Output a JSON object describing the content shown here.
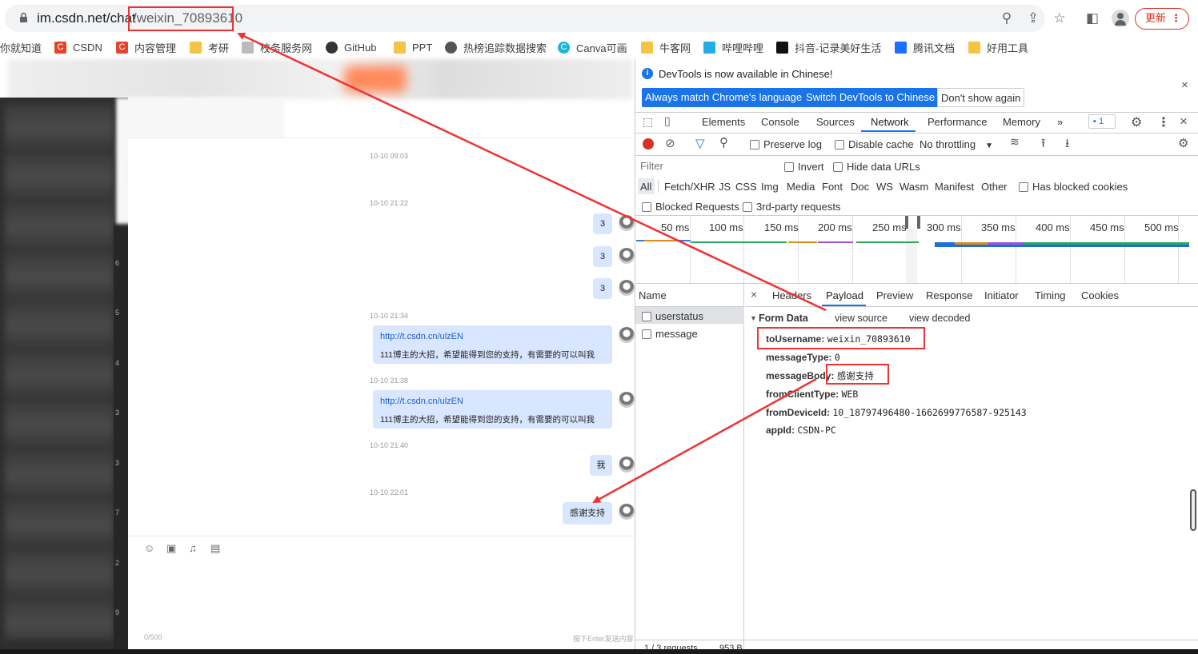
{
  "browser": {
    "url_host": "im.csdn.net/chat",
    "url_path": "/weixin_70893610",
    "update_label": "更新",
    "update_dots": "⋮",
    "toolbar_icons": [
      "zoom-icon",
      "share-icon",
      "star-icon",
      "sidebar-icon",
      "profile-icon"
    ]
  },
  "bookmarks": [
    {
      "label": "你就知道",
      "icon": ""
    },
    {
      "label": "CSDN",
      "icon": "C"
    },
    {
      "label": "内容管理",
      "icon": "C"
    },
    {
      "label": "考研",
      "icon": ""
    },
    {
      "label": "校务服务网",
      "icon": ""
    },
    {
      "label": "GitHub",
      "icon": ""
    },
    {
      "label": "PPT",
      "icon": ""
    },
    {
      "label": "热榜追踪数据搜索",
      "icon": ""
    },
    {
      "label": "Canva可画",
      "icon": "C"
    },
    {
      "label": "牛客网",
      "icon": ""
    },
    {
      "label": "哔哩哔哩",
      "icon": ""
    },
    {
      "label": "抖音-记录美好生活",
      "icon": ""
    },
    {
      "label": "腾讯文档",
      "icon": ""
    },
    {
      "label": "好用工具",
      "icon": ""
    }
  ],
  "chat": {
    "sidebar_numbers": [
      "6",
      "5",
      "4",
      "3",
      "3",
      "7",
      "2",
      "9"
    ],
    "messages": [
      {
        "time": "10-10 09:03"
      },
      {
        "time": "10-10 21:22",
        "text": "3"
      },
      {
        "text": "3"
      },
      {
        "text": "3"
      },
      {
        "time": "10-10 21:34",
        "link": "http://t.csdn.cn/ulzEN",
        "text": "111博主的大招，希望能得到您的支持，有需要的可以叫我"
      },
      {
        "time": "10-10 21:38",
        "link": "http://t.csdn.cn/ulzEN",
        "text": "111博主的大招，希望能得到您的支持，有需要的可以叫我"
      },
      {
        "time": "10-10 21:40",
        "text": "我"
      },
      {
        "time": "10-10 22:01",
        "text": "感谢支持"
      }
    ],
    "counter": "0/500",
    "send_hint": "按下Enter发送内容"
  },
  "devtools": {
    "info": "DevTools is now available in Chinese!",
    "btn_match": "Always match Chrome's language",
    "btn_switch": "Switch DevTools to Chinese",
    "btn_dont": "Don't show again",
    "tabs": [
      "Elements",
      "Console",
      "Sources",
      "Network",
      "Performance",
      "Memory"
    ],
    "more_tabs": "»",
    "issues_count": "1",
    "toolbar": {
      "preserve_log": "Preserve log",
      "disable_cache": "Disable cache",
      "throttling": "No throttling"
    },
    "filter_placeholder": "Filter",
    "invert": "Invert",
    "hide_data_urls": "Hide data URLs",
    "type_filters": [
      "All",
      "Fetch/XHR",
      "JS",
      "CSS",
      "Img",
      "Media",
      "Font",
      "Doc",
      "WS",
      "Wasm",
      "Manifest",
      "Other"
    ],
    "has_blocked_cookies": "Has blocked cookies",
    "blocked_requests": "Blocked Requests",
    "third_party": "3rd-party requests",
    "timeline_ticks": [
      "50 ms",
      "100 ms",
      "150 ms",
      "200 ms",
      "250 ms",
      "300 ms",
      "350 ms",
      "400 ms",
      "450 ms",
      "500 ms"
    ],
    "name_header": "Name",
    "requests": [
      "userstatus",
      "message"
    ],
    "detail_tabs": [
      "Headers",
      "Payload",
      "Preview",
      "Response",
      "Initiator",
      "Timing",
      "Cookies"
    ],
    "form_data_label": "Form Data",
    "view_source": "view source",
    "view_decoded": "view decoded",
    "payload": [
      {
        "key": "toUsername",
        "value": "weixin_70893610"
      },
      {
        "key": "messageType",
        "value": "0"
      },
      {
        "key": "messageBody",
        "value": "感谢支持"
      },
      {
        "key": "fromClientType",
        "value": "WEB"
      },
      {
        "key": "fromDeviceId",
        "value": "10_18797496480-1662699776587-925143"
      },
      {
        "key": "appId",
        "value": "CSDN-PC"
      }
    ],
    "status_bar": "1 / 3 requests",
    "status_size": "953 B"
  },
  "colors": {
    "accent": "#1a73e8",
    "annotation": "#e53333",
    "bubble": "#d9e6ff"
  }
}
